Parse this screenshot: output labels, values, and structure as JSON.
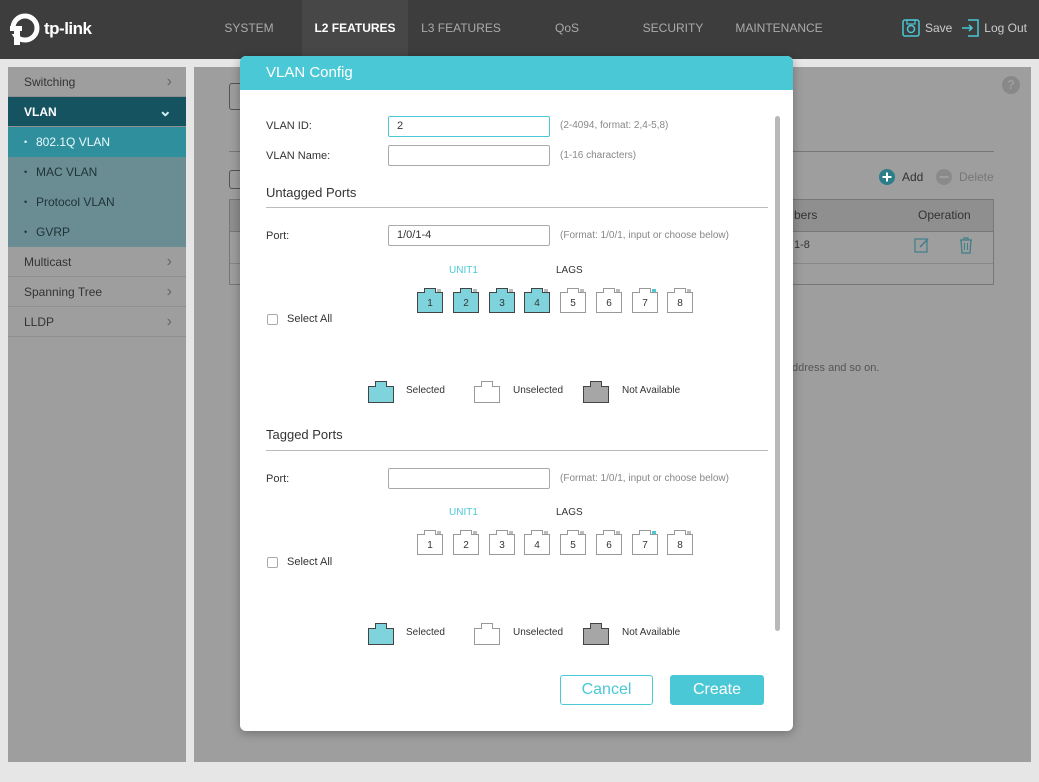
{
  "brand": {
    "logo_text": "tp-link"
  },
  "nav": {
    "tabs": [
      {
        "label": "SYSTEM"
      },
      {
        "label": "L2 FEATURES"
      },
      {
        "label": "L3 FEATURES"
      },
      {
        "label": "QoS"
      },
      {
        "label": "SECURITY"
      },
      {
        "label": "MAINTENANCE"
      }
    ],
    "active_tab": "L2 FEATURES",
    "save_label": "Save",
    "logout_label": "Log Out"
  },
  "sidebar": {
    "items": [
      {
        "label": "Switching"
      },
      {
        "label": "VLAN"
      },
      {
        "label": "802.1Q VLAN"
      },
      {
        "label": "MAC VLAN"
      },
      {
        "label": "Protocol VLAN"
      },
      {
        "label": "GVRP"
      },
      {
        "label": "Multicast"
      },
      {
        "label": "Spanning Tree"
      },
      {
        "label": "LLDP"
      }
    ]
  },
  "background": {
    "add_label": "Add",
    "delete_label": "Delete",
    "members_header": "bers",
    "operation_header": "Operation",
    "row_members": "1-8",
    "note_text": "ddress and so on."
  },
  "modal": {
    "title": "VLAN Config",
    "vlan_id": {
      "label": "VLAN ID:",
      "value": "2",
      "hint": "(2-4094, format: 2,4-5,8)"
    },
    "vlan_name": {
      "label": "VLAN Name:",
      "value": "",
      "hint": "(1-16 characters)"
    },
    "untagged": {
      "title": "Untagged Ports",
      "port_label": "Port:",
      "port_value": "1/0/1-4",
      "port_hint": "(Format: 1/0/1, input or choose below)",
      "unit_label": "UNIT1",
      "lags_label": "LAGS",
      "select_all": "Select All",
      "ports": [
        {
          "num": "1",
          "state": "selected"
        },
        {
          "num": "2",
          "state": "selected"
        },
        {
          "num": "3",
          "state": "selected"
        },
        {
          "num": "4",
          "state": "selected"
        },
        {
          "num": "5",
          "state": "unselected"
        },
        {
          "num": "6",
          "state": "unselected"
        },
        {
          "num": "7",
          "state": "unselected",
          "link": true
        },
        {
          "num": "8",
          "state": "unselected"
        }
      ]
    },
    "tagged": {
      "title": "Tagged Ports",
      "port_label": "Port:",
      "port_value": "",
      "port_hint": "(Format: 1/0/1, input or choose below)",
      "unit_label": "UNIT1",
      "lags_label": "LAGS",
      "select_all": "Select All",
      "ports": [
        {
          "num": "1",
          "state": "unselected"
        },
        {
          "num": "2",
          "state": "unselected"
        },
        {
          "num": "3",
          "state": "unselected"
        },
        {
          "num": "4",
          "state": "unselected"
        },
        {
          "num": "5",
          "state": "unselected"
        },
        {
          "num": "6",
          "state": "unselected"
        },
        {
          "num": "7",
          "state": "unselected",
          "link": true
        },
        {
          "num": "8",
          "state": "unselected"
        }
      ]
    },
    "legend": {
      "selected": "Selected",
      "unselected": "Unselected",
      "not_available": "Not Available"
    },
    "cancel_label": "Cancel",
    "create_label": "Create"
  },
  "colors": {
    "accent": "#4bc8d6",
    "topbar": "#3d3d3d",
    "sidebar_active": "#14535f",
    "port_selected": "#7fd3dc",
    "port_not_available": "#a6a6a6"
  }
}
